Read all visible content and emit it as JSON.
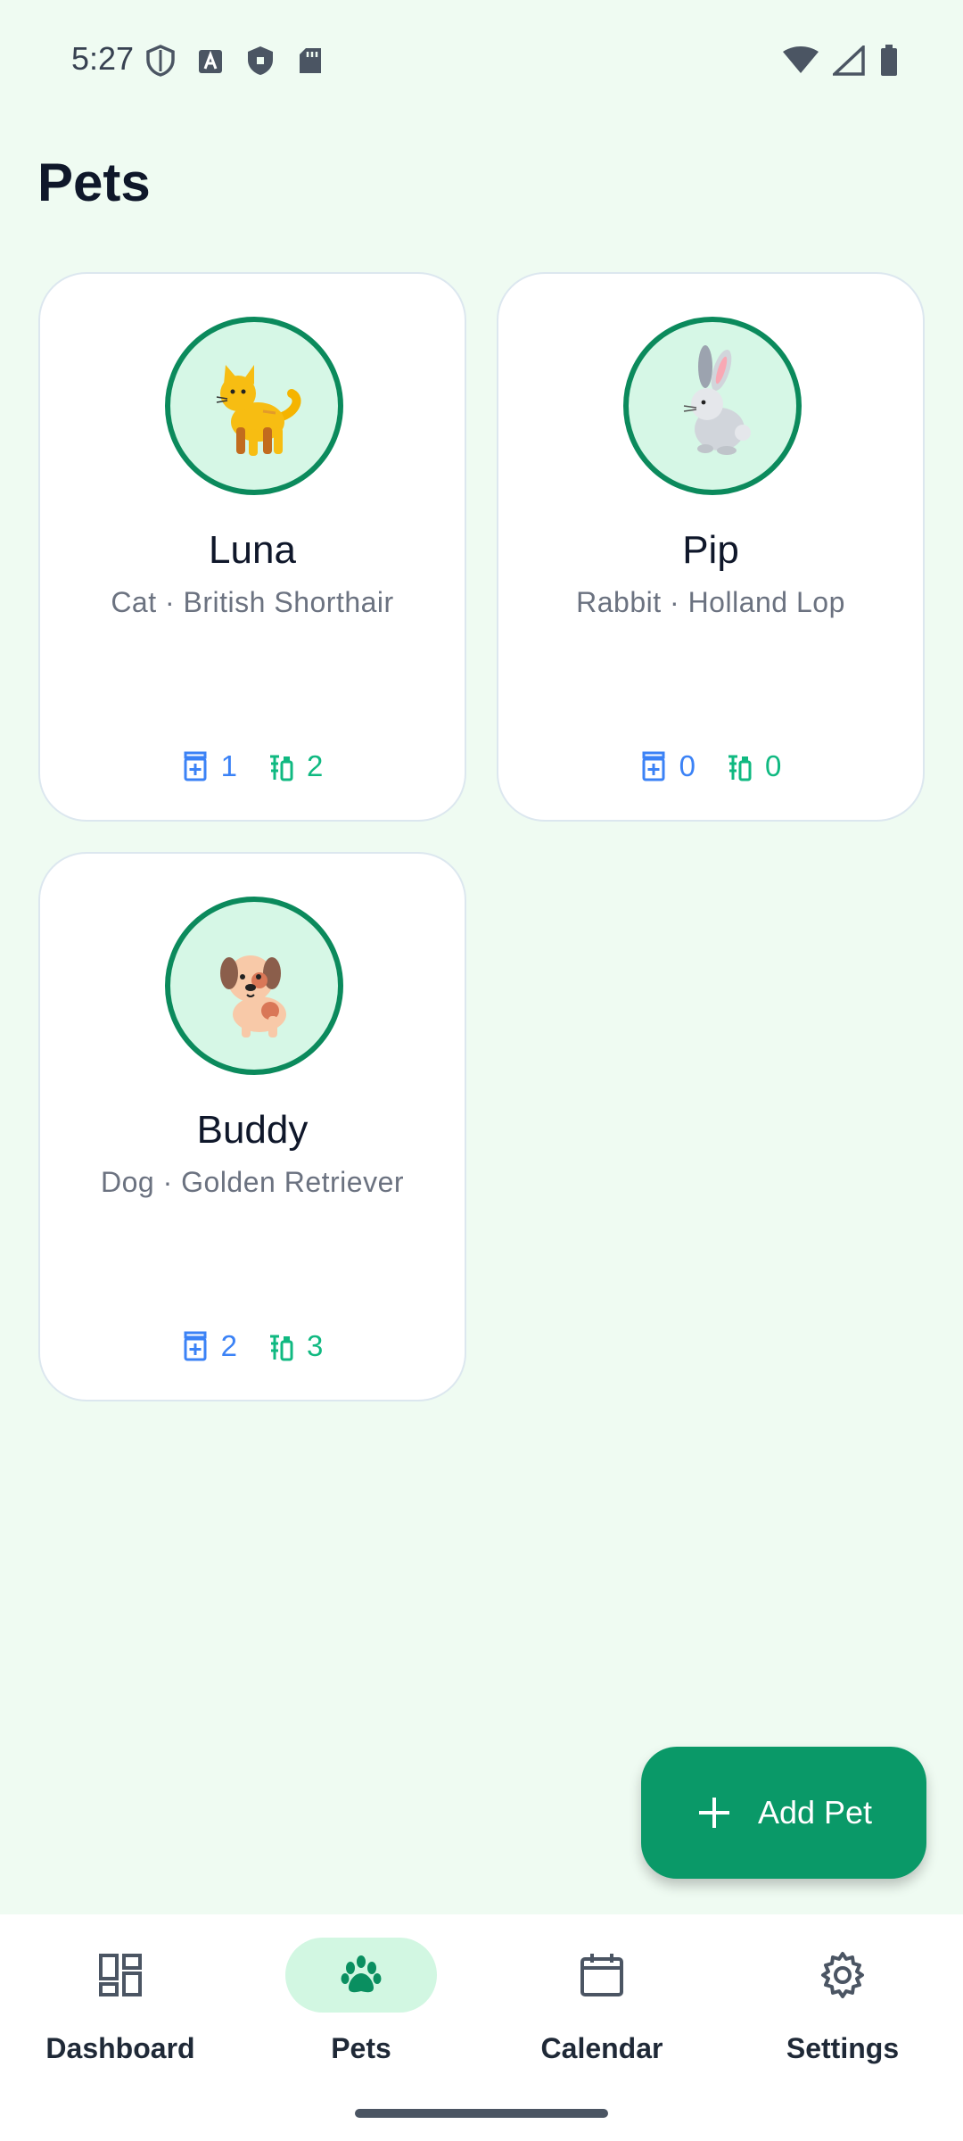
{
  "status_bar": {
    "time": "5:27",
    "left_icons": [
      "vpn-shield-icon",
      "font-a-icon",
      "shield-icon",
      "sd-card-icon"
    ],
    "right_icons": [
      "wifi-icon",
      "signal-icon",
      "battery-icon"
    ]
  },
  "header": {
    "title": "Pets"
  },
  "pets": [
    {
      "name": "Luna",
      "subtitle": "Cat · British Shorthair",
      "avatar_icon": "cat-icon",
      "medications": "1",
      "vaccinations": "2"
    },
    {
      "name": "Pip",
      "subtitle": "Rabbit · Holland Lop",
      "avatar_icon": "rabbit-icon",
      "medications": "0",
      "vaccinations": "0"
    },
    {
      "name": "Buddy",
      "subtitle": "Dog · Golden Retriever",
      "avatar_icon": "dog-icon",
      "medications": "2",
      "vaccinations": "3"
    }
  ],
  "fab": {
    "label": "Add Pet",
    "icon": "plus-icon"
  },
  "nav": {
    "items": [
      {
        "label": "Dashboard",
        "icon": "dashboard-icon",
        "active": false
      },
      {
        "label": "Pets",
        "icon": "paw-icon",
        "active": true
      },
      {
        "label": "Calendar",
        "icon": "calendar-icon",
        "active": false
      },
      {
        "label": "Settings",
        "icon": "gear-icon",
        "active": false
      }
    ]
  },
  "colors": {
    "background": "#EFFBF2",
    "primary": "#0A9968",
    "avatar_ring": "#0B8A5C",
    "medication": "#3B82F6",
    "vaccination": "#10B981",
    "nav_active_pill": "#D2F7E2"
  }
}
